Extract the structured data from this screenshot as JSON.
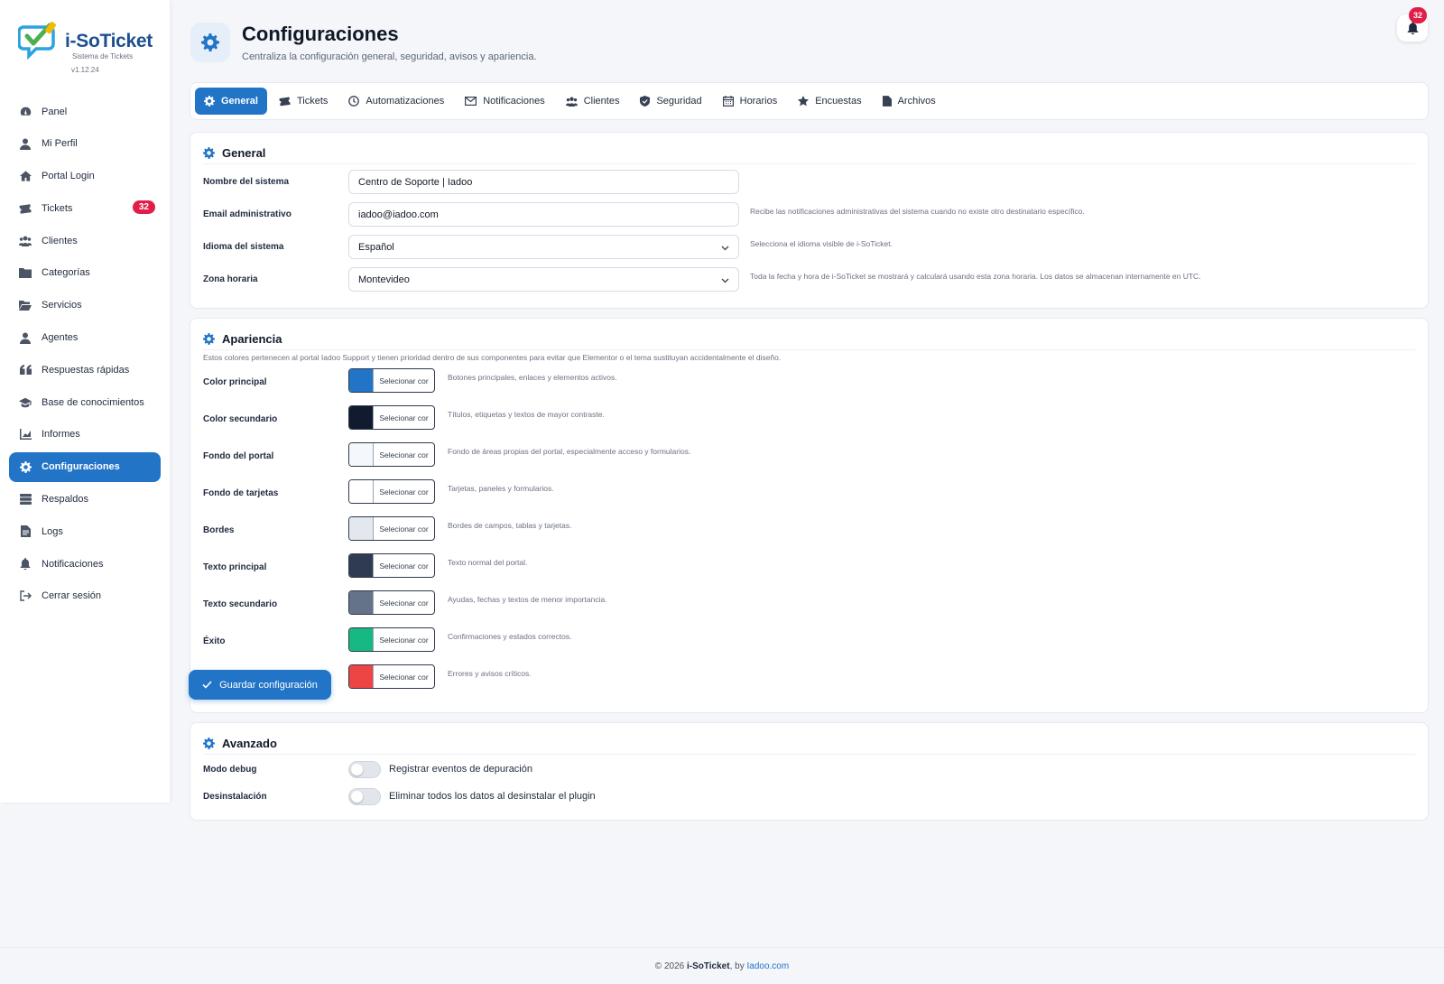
{
  "brand": {
    "name_prefix": "i-",
    "name_main": "SoTicket",
    "tagline": "Sistema de Tickets",
    "version": "v1.12.24"
  },
  "sidebar": {
    "items": [
      {
        "label": "Panel",
        "icon": "dashboard-icon"
      },
      {
        "label": "Mi Perfil",
        "icon": "user-icon"
      },
      {
        "label": "Portal Login",
        "icon": "home-icon"
      },
      {
        "label": "Tickets",
        "icon": "ticket-icon",
        "badge": "32"
      },
      {
        "label": "Clientes",
        "icon": "users-icon"
      },
      {
        "label": "Categorías",
        "icon": "folder-icon"
      },
      {
        "label": "Servicios",
        "icon": "folder-open-icon"
      },
      {
        "label": "Agentes",
        "icon": "user-icon"
      },
      {
        "label": "Respuestas rápidas",
        "icon": "quote-icon"
      },
      {
        "label": "Base de conocimientos",
        "icon": "graduation-cap-icon"
      },
      {
        "label": "Informes",
        "icon": "chart-icon"
      },
      {
        "label": "Configuraciones",
        "icon": "gear-icon",
        "active": true
      },
      {
        "label": "Respaldos",
        "icon": "database-icon"
      },
      {
        "label": "Logs",
        "icon": "file-icon"
      },
      {
        "label": "Notificaciones",
        "icon": "bell-icon"
      },
      {
        "label": "Cerrar sesión",
        "icon": "logout-icon"
      }
    ]
  },
  "header": {
    "title": "Configuraciones",
    "subtitle": "Centraliza la configuración general, seguridad, avisos y apariencia.",
    "notification_count": "32"
  },
  "tabs": [
    {
      "label": "General",
      "icon": "gear-icon",
      "active": true
    },
    {
      "label": "Tickets",
      "icon": "ticket-icon"
    },
    {
      "label": "Automatizaciones",
      "icon": "clock-icon"
    },
    {
      "label": "Notificaciones",
      "icon": "envelope-icon"
    },
    {
      "label": "Clientes",
      "icon": "users-icon"
    },
    {
      "label": "Seguridad",
      "icon": "shield-icon"
    },
    {
      "label": "Horarios",
      "icon": "calendar-icon"
    },
    {
      "label": "Encuestas",
      "icon": "star-icon"
    },
    {
      "label": "Archivos",
      "icon": "file-icon"
    }
  ],
  "general": {
    "title": "General",
    "fields": [
      {
        "label": "Nombre del sistema",
        "value": "Centro de Soporte | Iadoo",
        "hint": ""
      },
      {
        "label": "Email administrativo",
        "value": "iadoo@iadoo.com",
        "hint": "Recibe las notificaciones administrativas del sistema cuando no existe otro destinatario específico."
      },
      {
        "label": "Idioma del sistema",
        "value": "Español",
        "hint": "Selecciona el idioma visible de i-SoTicket."
      },
      {
        "label": "Zona horaria",
        "value": "Montevideo",
        "hint": "Toda la fecha y hora de i-SoTicket se mostrará y calculará usando esta zona horaria. Los datos se almacenan internamente en UTC."
      }
    ]
  },
  "appearance": {
    "title": "Apariencia",
    "note": "Estos colores pertenecen al portal Iadoo Support y tienen prioridad dentro de sus componentes para evitar que Elementor o el tema sustituyan accidentalmente el diseño.",
    "picker_label": "Selecionar cor",
    "colors": [
      {
        "label": "Color principal",
        "color": "#2274c7",
        "hint": "Botones principales, enlaces y elementos activos."
      },
      {
        "label": "Color secundario",
        "color": "#111a2e",
        "hint": "Títulos, etiquetas y textos de mayor contraste."
      },
      {
        "label": "Fondo del portal",
        "color": "#f4f7fb",
        "hint": "Fondo de áreas propias del portal, especialmente acceso y formularios."
      },
      {
        "label": "Fondo de tarjetas",
        "color": "#ffffff",
        "hint": "Tarjetas, paneles y formularios."
      },
      {
        "label": "Bordes",
        "color": "#e3e8ef",
        "hint": "Bordes de campos, tablas y tarjetas."
      },
      {
        "label": "Texto principal",
        "color": "#2f3b52",
        "hint": "Texto normal del portal."
      },
      {
        "label": "Texto secundario",
        "color": "#64728a",
        "hint": "Ayudas, fechas y textos de menor importancia."
      },
      {
        "label": "Éxito",
        "color": "#16b981",
        "hint": "Confirmaciones y estados correctos."
      },
      {
        "label": "",
        "color": "#ef4444",
        "hint": "Errores y avisos críticos."
      }
    ]
  },
  "advanced": {
    "title": "Avanzado",
    "rows": [
      {
        "label": "Modo debug",
        "toggle_label": "Registrar eventos de depuración",
        "on": false
      },
      {
        "label": "Desinstalación",
        "toggle_label": "Eliminar todos los datos al desinstalar el plugin",
        "on": false
      }
    ]
  },
  "save_button": "Guardar configuración",
  "footer": {
    "copyright": "© 2026 ",
    "product": "i-SoTicket",
    "by": ", by ",
    "link": "Iadoo.com"
  }
}
